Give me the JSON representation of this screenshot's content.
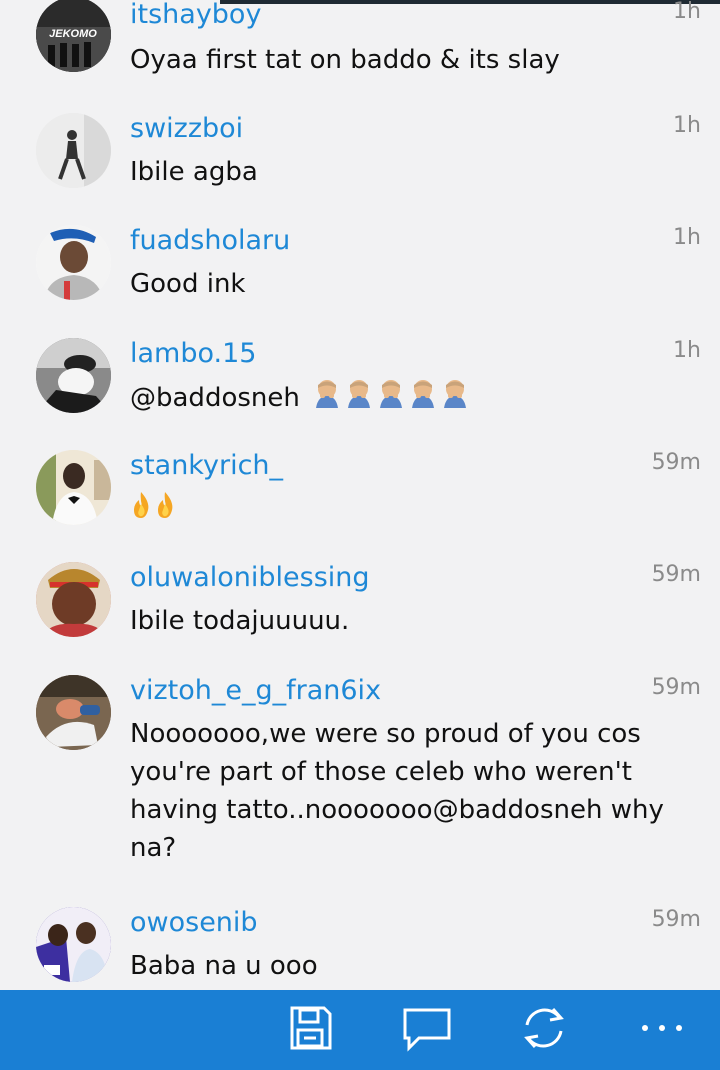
{
  "comments": [
    {
      "username": "itshayboy",
      "time": "1h",
      "text": "Oyaa first tat on baddo & its slay",
      "avatar_label": "JEKOMO"
    },
    {
      "username": "swizzboi",
      "time": "1h",
      "text": "Ibile agba"
    },
    {
      "username": "fuadsholaru",
      "time": "1h",
      "text": "Good ink"
    },
    {
      "username": "lambo.15",
      "time": "1h",
      "text": "@baddosneh",
      "emoji_count": 5,
      "emoji_name": "face-palm-icon"
    },
    {
      "username": "stankyrich_",
      "time": "59m",
      "text": "",
      "emoji_count": 2,
      "emoji_name": "fire-icon"
    },
    {
      "username": "oluwaloniblessing",
      "time": "59m",
      "text": "Ibile todajuuuuu."
    },
    {
      "username": "viztoh_e_g_fran6ix",
      "time": "59m",
      "text": "Nooooooo,we were so proud of you cos you're part of those celeb who weren't having tatto..nooooooo@baddosneh why na?"
    },
    {
      "username": "owosenib",
      "time": "59m",
      "text": "Baba na u ooo"
    }
  ],
  "bottombar": {
    "buttons": [
      "save-icon",
      "comment-icon",
      "refresh-icon",
      "more-icon"
    ]
  },
  "colors": {
    "username": "#1e88d6",
    "bar": "#1a7fd4",
    "background": "#f2f2f3"
  }
}
